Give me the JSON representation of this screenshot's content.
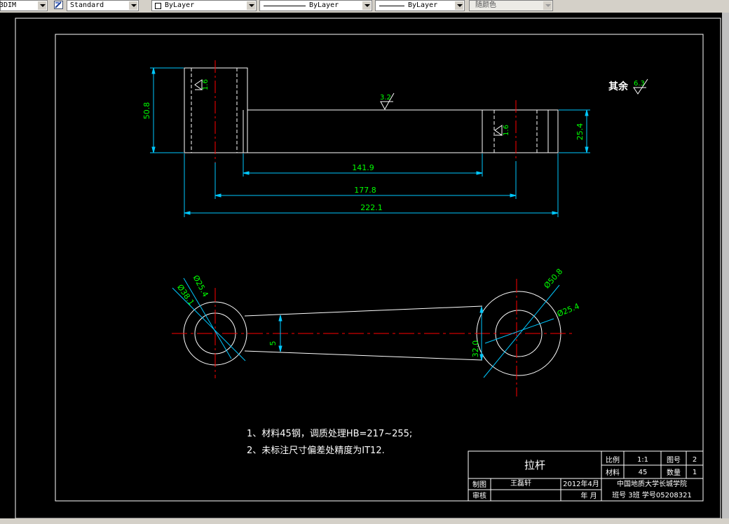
{
  "toolbar": {
    "dimstyle_value": "3DIM",
    "textstyle_value": "Standard",
    "layer_value": "ByLayer",
    "linetype_value": "ByLayer",
    "lineweight_value": "ByLayer",
    "color_value": "随颜色"
  },
  "colors": {
    "background": "#000000",
    "outline": "#ffffff",
    "dimension": "#00c8ff",
    "dimension_text": "#00ff00",
    "centerline": "#ff0000"
  },
  "drawing": {
    "front_view": {
      "height_dim": "50.8",
      "right_height_dim": "25.4",
      "len_inner": "141.9",
      "len_center": "177.8",
      "len_total": "222.1",
      "roughness_top": "3.2",
      "roughness_left": "1.6",
      "roughness_right": "1.6"
    },
    "top_view": {
      "left_inner_dia": "Ø25.4",
      "left_outer_dia": "Ø38.1",
      "right_outer_dia": "Ø50.8",
      "right_inner_dia": "Ø25.4",
      "link_width": "5",
      "right_width": "32.0"
    },
    "roughness_other_label": "其余",
    "roughness_other_value": "6.3",
    "notes": [
      "1、材料45钢，调质处理HB=217~255;",
      "2、未标注尺寸偏差处精度为IT12."
    ]
  },
  "title_block": {
    "part_name": "拉杆",
    "scale_label": "比例",
    "scale_value": "1:1",
    "drawing_no_label": "图号",
    "drawing_no_value": "2",
    "material_label": "材料",
    "material_value": "45",
    "quantity_label": "数量",
    "quantity_value": "1",
    "drawn_label": "制图",
    "drawn_by": "王磊轩",
    "date": "2012年4月",
    "checked_label": "审核",
    "year_month": "年    月",
    "school": "中国地质大学长城学院",
    "class_info": "班号 3班 学号05208321"
  }
}
